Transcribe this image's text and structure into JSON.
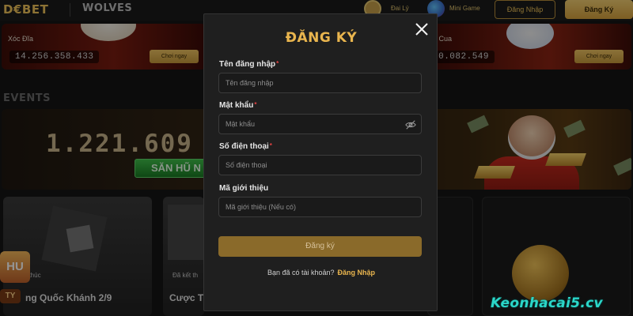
{
  "header": {
    "logo": "D€BET",
    "partner": "WOLVES",
    "nav_daily": "Đai Lý",
    "nav_mini_game": "Mini Game",
    "login_button": "Đăng Nhập",
    "register_button": "Đăng Ký"
  },
  "games": [
    {
      "title": "Xóc Đĩa",
      "amount": "14.256.358.433",
      "play_label": "Chơi ngay"
    },
    {
      "title": "ầu Cua",
      "amount": "20.082.549",
      "play_label": "Chơi ngay"
    }
  ],
  "events": {
    "heading": "EVENTS",
    "jackpot_value": "1.221.609",
    "jackpot_button": "SĂN HŨ N"
  },
  "promos": [
    {
      "status": "t thúc",
      "title": "ng Quốc Khánh 2/9"
    },
    {
      "status": "Đã kết th",
      "title": "Cược T"
    }
  ],
  "promo_tag": {
    "top": "HU",
    "bottom": "TY"
  },
  "watermark": "Keonhacai5.cv",
  "modal": {
    "title": "ĐĂNG KÝ",
    "fields": [
      {
        "label": "Tên đăng nhập",
        "required": "*",
        "placeholder": "Tên đăng nhập"
      },
      {
        "label": "Mật khẩu",
        "required": "*",
        "placeholder": "Mật khẩu"
      },
      {
        "label": "Số điện thoại",
        "required": "*",
        "placeholder": "Số điện thoại"
      },
      {
        "label": "Mã giới thiệu",
        "placeholder": "Mã giới thiệu (Nếu có)"
      }
    ],
    "submit_label": "Đăng ký",
    "have_account_text": "Bạn đã có tài khoản?",
    "login_link": "Đăng Nhập"
  },
  "colors": {
    "accent_gold": "#e9b54e",
    "required_red": "#e34242",
    "button_gold": "#8a6a2a",
    "watermark_teal": "#2bd6c8"
  },
  "icons": [
    "close-icon",
    "eye-slash-icon",
    "trophy-icon",
    "globe-icon"
  ]
}
